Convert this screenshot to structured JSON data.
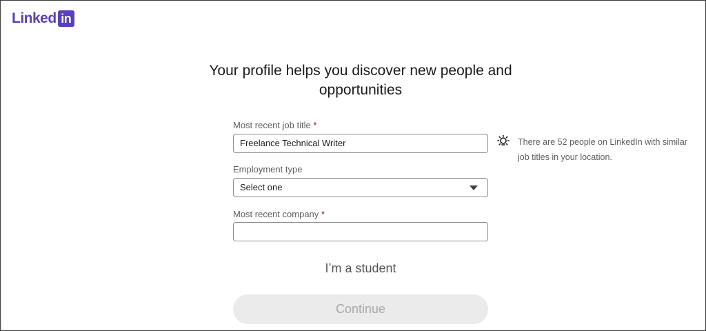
{
  "brand": {
    "logo_text": "Linked",
    "logo_box_text": "in",
    "color": "#5a3fc0"
  },
  "heading": {
    "line1": "Your profile helps you discover new people and",
    "line2": "opportunities"
  },
  "form": {
    "job_title": {
      "label": "Most recent job title",
      "required_mark": "*",
      "value": "Freelance Technical Writer"
    },
    "employment_type": {
      "label": "Employment type",
      "selected": "Select one"
    },
    "company": {
      "label": "Most recent company",
      "required_mark": "*",
      "value": ""
    }
  },
  "tip": {
    "icon": "lightbulb-icon",
    "text": "There are 52 people on LinkedIn with similar job titles in your location."
  },
  "student_link": "I’m a student",
  "continue_button": "Continue"
}
